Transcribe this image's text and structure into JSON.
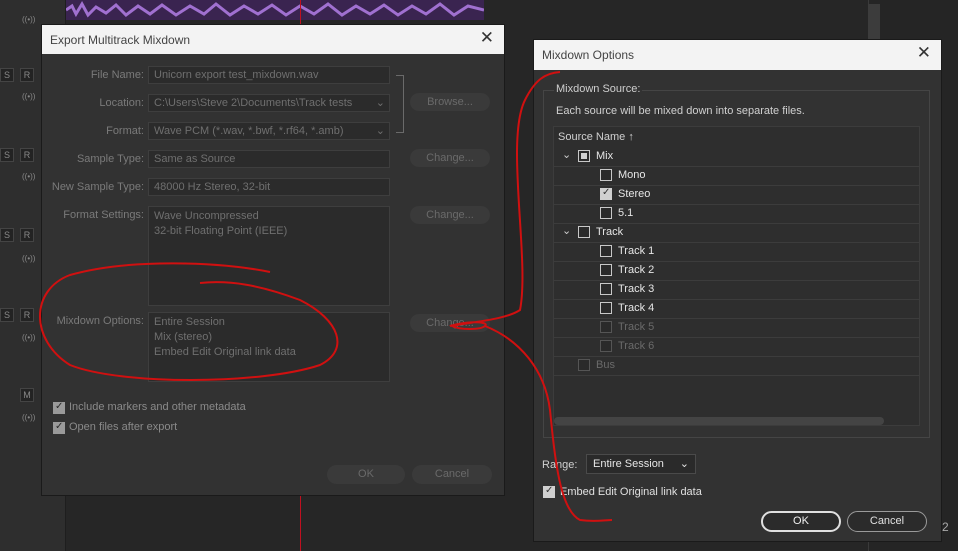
{
  "export_dialog": {
    "title": "Export Multitrack Mixdown",
    "close": "✕",
    "file_name_label": "File Name:",
    "file_name_value": "Unicorn export test_mixdown.wav",
    "location_label": "Location:",
    "location_value": "C:\\Users\\Steve 2\\Documents\\Track tests",
    "browse_label": "Browse...",
    "format_label": "Format:",
    "format_value": "Wave PCM (*.wav, *.bwf, *.rf64, *.amb)",
    "sample_type_label": "Sample Type:",
    "sample_type_value": "Same as Source",
    "change_label": "Change...",
    "new_sample_type_label": "New Sample Type:",
    "new_sample_type_value": "48000 Hz Stereo, 32-bit",
    "format_settings_label": "Format Settings:",
    "format_settings_line1": "Wave Uncompressed",
    "format_settings_line2": "32-bit Floating Point (IEEE)",
    "mixdown_options_label": "Mixdown Options:",
    "mixdown_line1": "Entire Session",
    "mixdown_line2": "Mix (stereo)",
    "mixdown_line3": "Embed Edit Original link data",
    "include_markers_label": "Include markers and other metadata",
    "open_files_label": "Open files after export",
    "ok_label": "OK",
    "cancel_label": "Cancel"
  },
  "mixdown_dialog": {
    "title": "Mixdown Options",
    "close": "✕",
    "source_group_label": "Mixdown Source:",
    "source_desc": "Each source will be mixed down into separate files.",
    "column_header": "Source Name",
    "sort_arrow": "↑",
    "tree": [
      {
        "label": "Mix",
        "level": 0,
        "state": "indeterminate",
        "expanded": true
      },
      {
        "label": "Mono",
        "level": 1,
        "state": "unchecked"
      },
      {
        "label": "Stereo",
        "level": 1,
        "state": "checked"
      },
      {
        "label": "5.1",
        "level": 1,
        "state": "unchecked"
      },
      {
        "label": "Track",
        "level": 0,
        "state": "unchecked",
        "expanded": true
      },
      {
        "label": "Track 1",
        "level": 1,
        "state": "unchecked"
      },
      {
        "label": "Track 2",
        "level": 1,
        "state": "unchecked"
      },
      {
        "label": "Track 3",
        "level": 1,
        "state": "unchecked"
      },
      {
        "label": "Track 4",
        "level": 1,
        "state": "unchecked"
      },
      {
        "label": "Track 5",
        "level": 1,
        "state": "disabled"
      },
      {
        "label": "Track 6",
        "level": 1,
        "state": "disabled"
      },
      {
        "label": "Bus",
        "level": 0,
        "state": "disabled"
      }
    ],
    "range_label": "Range:",
    "range_value": "Entire Session",
    "embed_label": "Embed Edit Original link data",
    "ok_label": "OK",
    "cancel_label": "Cancel"
  },
  "daw": {
    "track_buttons": [
      "S",
      "R",
      "S",
      "R",
      "S",
      "R",
      "S",
      "R",
      "M"
    ],
    "io_icon": "((•))",
    "corner_digits": "2"
  },
  "colors": {
    "annotation_red": "#d01010",
    "playhead": "#c01020",
    "waveform": "#9060c0"
  }
}
